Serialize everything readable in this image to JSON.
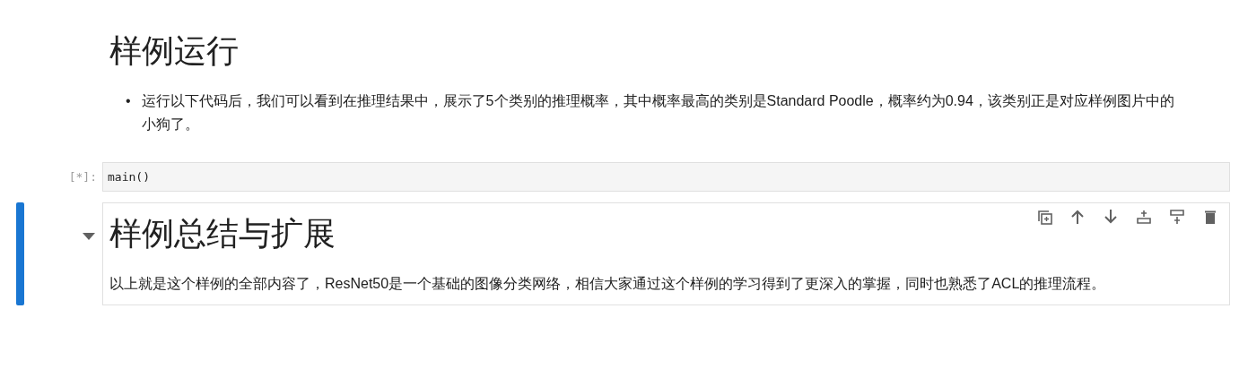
{
  "cells": [
    {
      "kind": "markdown",
      "selected": false,
      "heading": "样例运行",
      "bullets": [
        {
          "marker": "•",
          "text": "运行以下代码后，我们可以看到在推理结果中，展示了5个类别的推理概率，其中概率最高的类别是Standard Poodle，概率约为0.94，该类别正是对应样例图片中的小狗了。"
        }
      ]
    },
    {
      "kind": "code",
      "selected": false,
      "prompt": "[*]:",
      "source": "main()"
    },
    {
      "kind": "markdown",
      "selected": true,
      "expanded": true,
      "heading": "样例总结与扩展",
      "paragraph": "以上就是这个样例的全部内容了，ResNet50是一个基础的图像分类网络，相信大家通过这个样例的学习得到了更深入的掌握，同时也熟悉了ACL的推理流程。"
    }
  ]
}
